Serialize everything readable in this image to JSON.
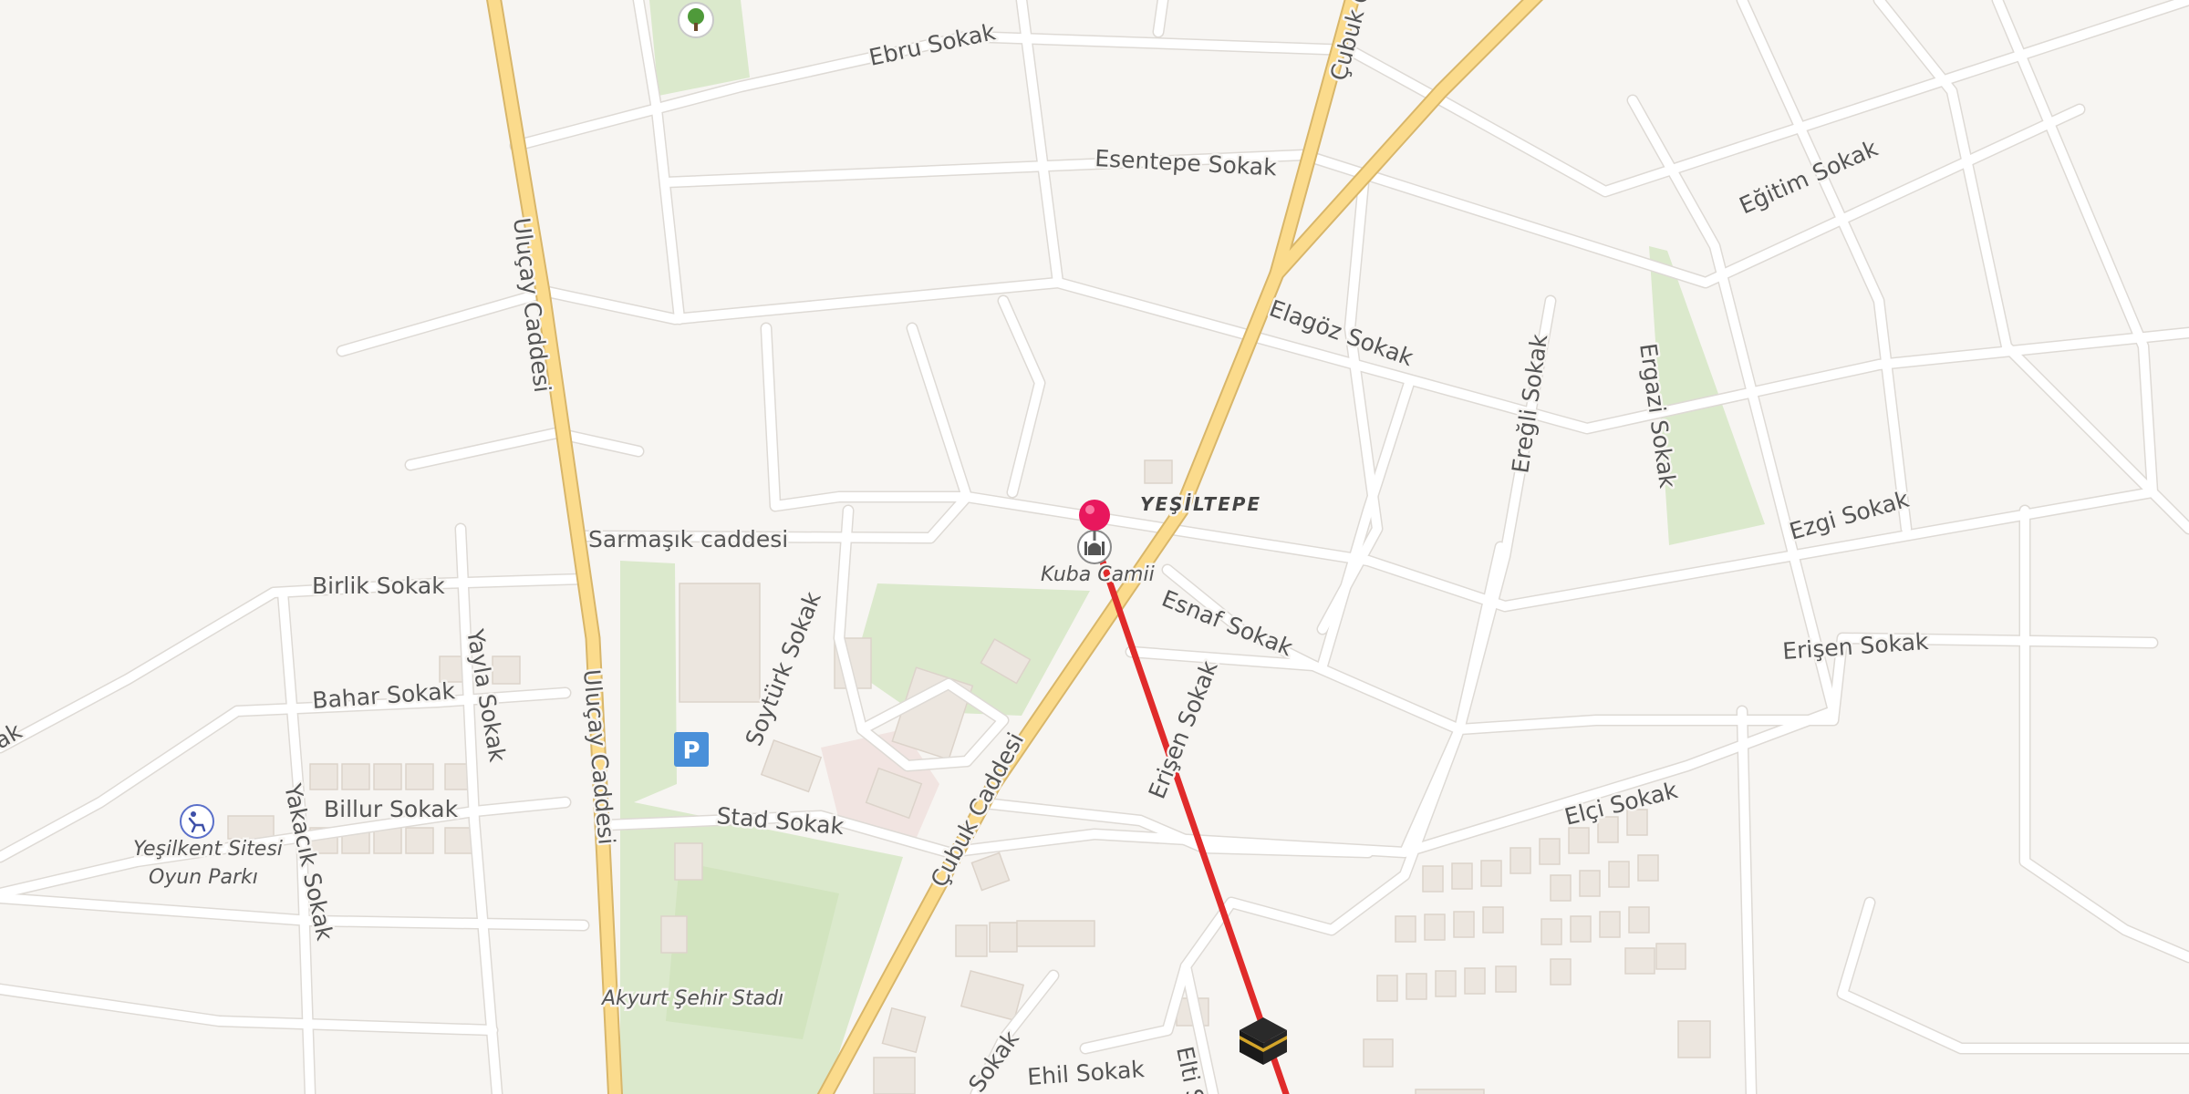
{
  "map": {
    "colors": {
      "background": "#f7f5f2",
      "street": "#ffffff",
      "main_road": "#fbdb8c",
      "green_area": "#dbe9cc",
      "building": "#ece6df",
      "route": "#e02b2b",
      "pin": "#e8175d",
      "parking": "#4a90d9"
    },
    "neighborhood": "YEŞİLTEPE",
    "streets": {
      "ulucay_1": "Uluçay Caddesi",
      "ulucay_2": "Uluçay Caddesi",
      "ebru": "Ebru Sokak",
      "cubuk_top": "Çubuk C",
      "esentepe": "Esentepe Sokak",
      "egitim": "Eğitim Sokak",
      "elagoz": "Elagöz Sokak",
      "eregli": "Ereğli Sokak",
      "ergazi": "Ergazi Sokak",
      "sarmasik": "Sarmaşık caddesi",
      "ezgi": "Ezgi Sokak",
      "birlik": "Birlik Sokak",
      "yayla": "Yayla Sokak",
      "esnaf": "Esnaf Sokak",
      "soyturk": "Soytürk Sokak",
      "erisen_1": "Erişen Sokak",
      "erisen_2": "Erişen Sokak",
      "bahar": "Bahar Sokak",
      "billur": "Billur Sokak",
      "yakacik": "Yakacık Sokak",
      "stad": "Stad Sokak",
      "cubuk": "Çubuk Caddesi",
      "elci": "Elçi Sokak",
      "ehil": "Ehil Sokak",
      "elti": "Elti S",
      "partial_sokak": "Sokak",
      "partial_left": "ak"
    },
    "pois": {
      "kuba_camii": "Kuba Camii",
      "yesilkent_line1": "Yeşilkent Sitesi",
      "yesilkent_line2": "Oyun Parkı",
      "stadium": "Akyurt Şehir Stadı",
      "parking_symbol": "P"
    },
    "icons": {
      "pin": "map-pin-icon",
      "mosque": "mosque-icon",
      "kaaba": "kaaba-icon",
      "tree": "tree-icon",
      "playground": "playground-icon",
      "parking": "parking-icon"
    }
  }
}
